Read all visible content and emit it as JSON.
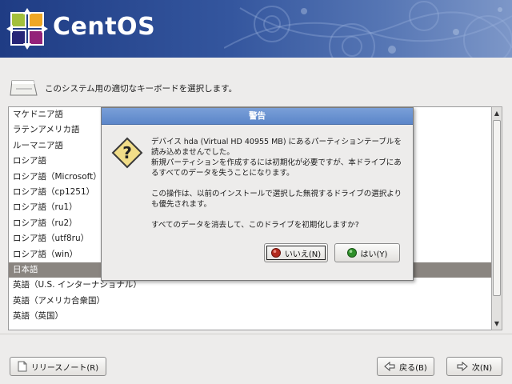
{
  "banner": {
    "logo_text": "CentOS",
    "logo_icon": "centos-pinwheel-icon"
  },
  "prompt": {
    "icon": "keyboard-icon",
    "text": "このシステム用の適切なキーボードを選択します。"
  },
  "keyboard_list": {
    "items": [
      "マケドニア語",
      "ラテンアメリカ語",
      "ルーマニア語",
      "ロシア語",
      "ロシア語（Microsoft）",
      "ロシア語（cp1251）",
      "ロシア語（ru1）",
      "ロシア語（ru2）",
      "ロシア語（utf8ru）",
      "ロシア語（win）",
      "日本語",
      "英語（U.S. インターナショナル）",
      "英語（アメリカ合衆国）",
      "英語（英国）"
    ],
    "selected": "日本語"
  },
  "dialog": {
    "title": "警告",
    "icon": "question-icon",
    "paragraph1": "デバイス hda (Virtual HD 40955 MB) にあるパーティションテーブルを読み込めませんでした。\n新規パーティションを作成するには初期化が必要ですが、本ドライブにあるすべてのデータを失うことになります。",
    "paragraph2": "この操作は、以前のインストールで選択した無視するドライブの選択よりも優先されます。",
    "paragraph3": "すべてのデータを消去して、このドライブを初期化しますか?",
    "no_label": "いいえ(N)",
    "yes_label": "はい(Y)"
  },
  "footer": {
    "release_notes_label": "リリースノート(R)",
    "back_label": "戻る(B)",
    "next_label": "次(N)"
  },
  "colors": {
    "banner": "#1f3c84",
    "selection": "#8a8580",
    "dialog_title": "#5b86c9"
  }
}
